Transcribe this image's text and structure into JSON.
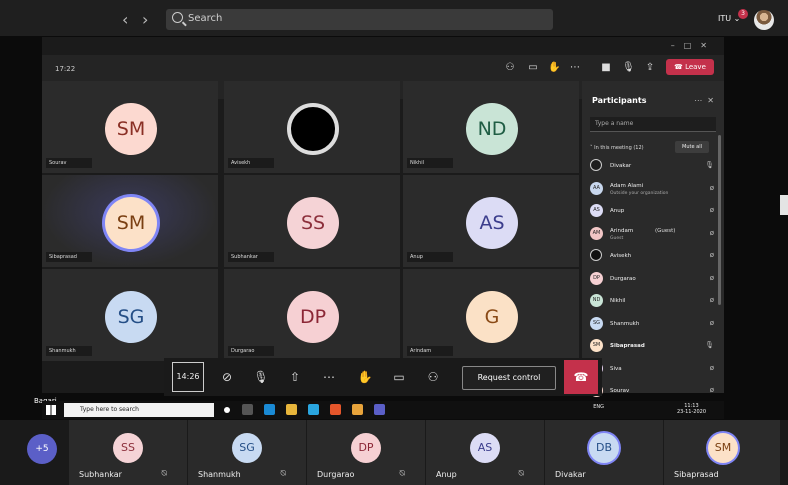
{
  "top_bar": {
    "search_placeholder": "Search",
    "org_label": "ITU ⌄",
    "notification_count": "3"
  },
  "meeting": {
    "clock": "17:22",
    "leave_label": "Leave",
    "tiles": [
      {
        "initials": "SM",
        "name": "Sourav",
        "bg": "#fcd9d0",
        "fg": "#8a2f24"
      },
      {
        "initials": "",
        "name": "Avisekh",
        "bg": "#000000",
        "fg": "#ffffff"
      },
      {
        "initials": "ND",
        "name": "Nikhil",
        "bg": "#c9e4d6",
        "fg": "#1f5d44"
      },
      {
        "initials": "SM",
        "name": "Sibaprasad",
        "bg": "#fce1c8",
        "fg": "#7a3f12"
      },
      {
        "initials": "SS",
        "name": "Subhankar",
        "bg": "#f5d3d6",
        "fg": "#8c2f3b"
      },
      {
        "initials": "AS",
        "name": "Anup",
        "bg": "#dcdcf5",
        "fg": "#3b3d8c"
      },
      {
        "initials": "SG",
        "name": "Shanmukh",
        "bg": "#c8daf2",
        "fg": "#244e86"
      },
      {
        "initials": "DP",
        "name": "Durgarao",
        "bg": "#f6d0d3",
        "fg": "#8b2635"
      },
      {
        "initials": "G",
        "name": "Arindam",
        "bg": "#fbe1c6",
        "fg": "#8a4a16"
      }
    ]
  },
  "participants": {
    "title": "Participants",
    "search_placeholder": "Type a name",
    "in_meeting_label": "˅ In this meeting (12)",
    "mute_all_label": "Mute all",
    "list": [
      {
        "initials": "D",
        "name": "Divakar",
        "sub": "",
        "guest": "",
        "mic": "🎙",
        "bg": "#1e1e1e"
      },
      {
        "initials": "AA",
        "name": "Adam Alami",
        "sub": "Outside your organization",
        "guest": "",
        "mic": "ø",
        "bg": "#c8d7ee"
      },
      {
        "initials": "AS",
        "name": "Anup",
        "sub": "",
        "guest": "",
        "mic": "ø",
        "bg": "#dcdcf5"
      },
      {
        "initials": "AM",
        "name": "Arindam",
        "sub": "Guest",
        "guest": "(Guest)",
        "mic": "ø",
        "bg": "#f1c6c6"
      },
      {
        "initials": "",
        "name": "Avisekh",
        "sub": "",
        "guest": "",
        "mic": "ø",
        "bg": "#111111"
      },
      {
        "initials": "DP",
        "name": "Durgarao",
        "sub": "",
        "guest": "",
        "mic": "ø",
        "bg": "#f6d0d3"
      },
      {
        "initials": "ND",
        "name": "Nikhil",
        "sub": "",
        "guest": "",
        "mic": "ø",
        "bg": "#c9e4d6"
      },
      {
        "initials": "SG",
        "name": "Shanmukh",
        "sub": "",
        "guest": "",
        "mic": "ø",
        "bg": "#c8daf2"
      },
      {
        "initials": "SM",
        "name": "Sibaprasad",
        "sub": "",
        "guest": "",
        "mic": "🎙",
        "bg": "#fce1c8"
      },
      {
        "initials": "S",
        "name": "Siva",
        "sub": "",
        "guest": "",
        "mic": "ø",
        "bg": "#e8d4f2"
      },
      {
        "initials": "S",
        "name": "Sourav",
        "sub": "",
        "guest": "",
        "mic": "ø",
        "bg": "#fcd9d0"
      }
    ]
  },
  "share_bar": {
    "timer": "14:26",
    "request_control_label": "Request control"
  },
  "taskbar": {
    "user_label": "Bagari",
    "search_placeholder": "Type here to search",
    "lang": "ENG",
    "time": "11:13",
    "date": "23-11-2020"
  },
  "strip": {
    "more_label": "+5",
    "tiles": [
      {
        "initials": "SS",
        "name": "Subhankar",
        "bg": "#f5d3d6",
        "fg": "#8c2f3b"
      },
      {
        "initials": "SG",
        "name": "Shanmukh",
        "bg": "#c8daf2",
        "fg": "#244e86"
      },
      {
        "initials": "DP",
        "name": "Durgarao",
        "bg": "#f6d0d3",
        "fg": "#8b2635"
      },
      {
        "initials": "AS",
        "name": "Anup",
        "bg": "#dcdcf5",
        "fg": "#3b3d8c"
      },
      {
        "initials": "DB",
        "name": "Divakar",
        "bg": "#c8daf2",
        "fg": "#244e86"
      },
      {
        "initials": "SM",
        "name": "Sibaprasad",
        "bg": "#fce1c8",
        "fg": "#7a3f12"
      }
    ]
  }
}
